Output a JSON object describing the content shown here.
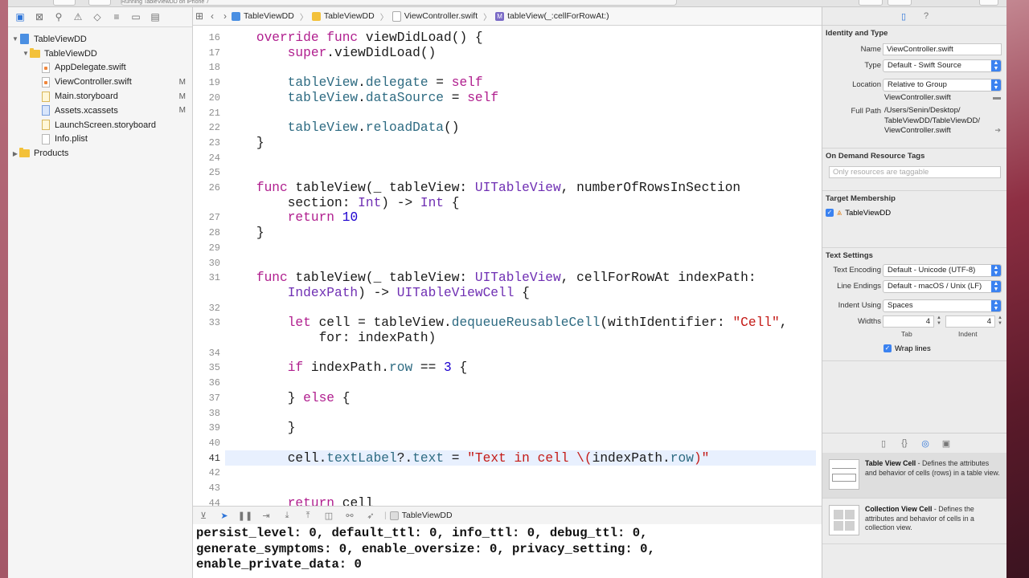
{
  "titlebar": {
    "status_text": "Running TableViewDD on iPhone 7"
  },
  "navigator": {
    "tree": [
      {
        "label": "TableViewDD",
        "kind": "project",
        "indent": 0,
        "disclosure": "▼",
        "badge": ""
      },
      {
        "label": "TableViewDD",
        "kind": "folder",
        "indent": 1,
        "disclosure": "▼",
        "badge": ""
      },
      {
        "label": "AppDelegate.swift",
        "kind": "swift",
        "indent": 2,
        "disclosure": "",
        "badge": ""
      },
      {
        "label": "ViewController.swift",
        "kind": "swift",
        "indent": 2,
        "disclosure": "",
        "badge": "M",
        "selected": true
      },
      {
        "label": "Main.storyboard",
        "kind": "storyboard",
        "indent": 2,
        "disclosure": "",
        "badge": "M"
      },
      {
        "label": "Assets.xcassets",
        "kind": "assets",
        "indent": 2,
        "disclosure": "",
        "badge": "M"
      },
      {
        "label": "LaunchScreen.storyboard",
        "kind": "storyboard",
        "indent": 2,
        "disclosure": "",
        "badge": ""
      },
      {
        "label": "Info.plist",
        "kind": "plist",
        "indent": 2,
        "disclosure": "",
        "badge": ""
      },
      {
        "label": "Products",
        "kind": "folder",
        "indent": 0,
        "disclosure": "▶",
        "badge": ""
      }
    ]
  },
  "jumpbar": {
    "project": "TableViewDD",
    "group": "TableViewDD",
    "file": "ViewController.swift",
    "method": "tableView(_:cellForRowAt:)",
    "method_badge": "M"
  },
  "editor": {
    "highlight_line": "41",
    "lines": [
      {
        "num": "16",
        "html": "    <span class=\"k\">override func</span> viewDidLoad() {"
      },
      {
        "num": "17",
        "html": "        <span class=\"k\">super</span>.viewDidLoad()"
      },
      {
        "num": "18",
        "html": ""
      },
      {
        "num": "19",
        "html": "        <span class=\"p\">tableView</span>.<span class=\"p\">delegate</span> = <span class=\"k\">self</span>"
      },
      {
        "num": "20",
        "html": "        <span class=\"p\">tableView</span>.<span class=\"p\">dataSource</span> = <span class=\"k\">self</span>"
      },
      {
        "num": "21",
        "html": ""
      },
      {
        "num": "22",
        "html": "        <span class=\"p\">tableView</span>.<span class=\"p\">reloadData</span>()"
      },
      {
        "num": "23",
        "html": "    }"
      },
      {
        "num": "24",
        "html": ""
      },
      {
        "num": "25",
        "html": ""
      },
      {
        "num": "26",
        "html": "    <span class=\"k\">func</span> tableView(_ tableView: <span class=\"t\">UITableView</span>, numberOfRowsInSection"
      },
      {
        "num": "",
        "html": "        section: <span class=\"t\">Int</span>) -> <span class=\"t\">Int</span> {"
      },
      {
        "num": "27",
        "html": "        <span class=\"k\">return</span> <span class=\"n\">10</span>"
      },
      {
        "num": "28",
        "html": "    }"
      },
      {
        "num": "29",
        "html": ""
      },
      {
        "num": "30",
        "html": ""
      },
      {
        "num": "31",
        "html": "    <span class=\"k\">func</span> tableView(_ tableView: <span class=\"t\">UITableView</span>, cellForRowAt indexPath:"
      },
      {
        "num": "",
        "html": "        <span class=\"t\">IndexPath</span>) -> <span class=\"t\">UITableViewCell</span> {"
      },
      {
        "num": "32",
        "html": ""
      },
      {
        "num": "33",
        "html": "        <span class=\"k\">let</span> cell = tableView.<span class=\"p\">dequeueReusableCell</span>(withIdentifier: <span class=\"s\">\"Cell\"</span>,"
      },
      {
        "num": "",
        "html": "            for: indexPath)"
      },
      {
        "num": "34",
        "html": ""
      },
      {
        "num": "35",
        "html": "        <span class=\"k\">if</span> indexPath.<span class=\"p\">row</span> == <span class=\"n\">3</span> {"
      },
      {
        "num": "36",
        "html": ""
      },
      {
        "num": "37",
        "html": "        } <span class=\"k\">else</span> {"
      },
      {
        "num": "38",
        "html": ""
      },
      {
        "num": "39",
        "html": "        }"
      },
      {
        "num": "40",
        "html": ""
      },
      {
        "num": "41",
        "html": "        cell.<span class=\"p\">textLabel</span>?.<span class=\"p\">text</span> = <span class=\"s\">\"Text in cell \\(</span>indexPath.<span class=\"p\">row</span><span class=\"s\">)\"</span>"
      },
      {
        "num": "42",
        "html": ""
      },
      {
        "num": "43",
        "html": ""
      },
      {
        "num": "44",
        "html": "        <span class=\"k\">return</span> cell"
      }
    ]
  },
  "debugbar": {
    "target": "TableViewDD"
  },
  "console": {
    "lines": [
      "persist_level: 0, default_ttl: 0, info_ttl: 0, debug_ttl: 0,",
      "generate_symptoms: 0, enable_oversize: 0, privacy_setting: 0,",
      "enable_private_data: 0"
    ]
  },
  "inspector": {
    "identity": {
      "title": "Identity and Type",
      "name_label": "Name",
      "name_value": "ViewController.swift",
      "type_label": "Type",
      "type_value": "Default - Swift Source",
      "location_label": "Location",
      "location_value": "Relative to Group",
      "location_file": "ViewController.swift",
      "fullpath_label": "Full Path",
      "fullpath_lines": [
        "/Users/Senin/Desktop/",
        "TableViewDD/TableViewDD/",
        "ViewController.swift"
      ]
    },
    "odr": {
      "title": "On Demand Resource Tags",
      "placeholder": "Only resources are taggable"
    },
    "target": {
      "title": "Target Membership",
      "item": "TableViewDD"
    },
    "text_settings": {
      "title": "Text Settings",
      "encoding_label": "Text Encoding",
      "encoding_value": "Default - Unicode (UTF-8)",
      "endings_label": "Line Endings",
      "endings_value": "Default - macOS / Unix (LF)",
      "indent_label": "Indent Using",
      "indent_value": "Spaces",
      "widths_label": "Widths",
      "tab_value": "4",
      "indent_width_value": "4",
      "tab_caption": "Tab",
      "indent_caption": "Indent",
      "wrap_label": "Wrap lines"
    },
    "library": [
      {
        "title": "Table View Cell",
        "desc": " - Defines the attributes and behavior of cells (rows) in a table view."
      },
      {
        "title": "Collection View Cell",
        "desc": " - Defines the attributes and behavior of cells in a collection view."
      }
    ]
  },
  "colors": {
    "accent": "#2d74d8",
    "keyword": "#b01e8e",
    "type": "#6f2fb3",
    "property": "#2e6b82",
    "string": "#c41a16",
    "number": "#1c00cf",
    "line_highlight": "#e8f0fe"
  }
}
